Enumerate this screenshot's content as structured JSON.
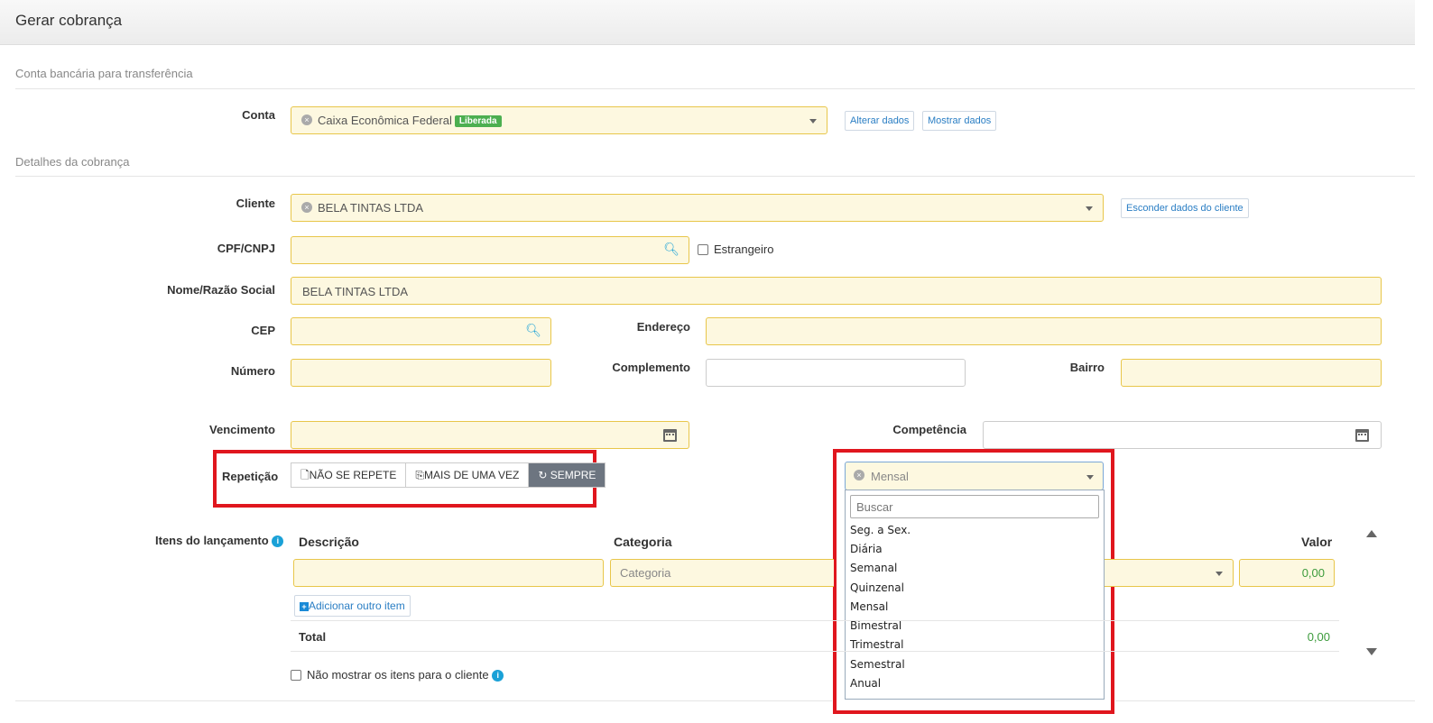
{
  "header": {
    "title": "Gerar cobrança"
  },
  "sections": {
    "bank": "Conta bancária para transferência",
    "details": "Detalhes da cobrança"
  },
  "conta": {
    "label": "Conta",
    "value": "Caixa Econômica Federal",
    "badge": "Liberada",
    "btn_alterar": "Alterar dados",
    "btn_mostrar": "Mostrar dados"
  },
  "cliente": {
    "label": "Cliente",
    "value": "BELA TINTAS LTDA",
    "btn_esconder": "Esconder dados do cliente"
  },
  "cpf": {
    "label": "CPF/CNPJ",
    "value": "",
    "estrangeiro_label": "Estrangeiro"
  },
  "nome": {
    "label": "Nome/Razão Social",
    "value": "BELA TINTAS LTDA"
  },
  "cep": {
    "label": "CEP",
    "value": ""
  },
  "endereco": {
    "label": "Endereço",
    "value": ""
  },
  "numero": {
    "label": "Número",
    "value": ""
  },
  "complemento": {
    "label": "Complemento",
    "value": ""
  },
  "bairro": {
    "label": "Bairro",
    "value": ""
  },
  "vencimento": {
    "label": "Vencimento",
    "value": ""
  },
  "competencia": {
    "label": "Competência",
    "value": ""
  },
  "repeticao": {
    "label": "Repetição",
    "options": [
      "NÃO SE REPETE",
      "MAIS DE UMA VEZ",
      "SEMPRE"
    ],
    "active": "SEMPRE"
  },
  "frequencia": {
    "selected": "Mensal",
    "search_placeholder": "Buscar",
    "options": [
      "Seg. a Sex.",
      "Diária",
      "Semanal",
      "Quinzenal",
      "Mensal",
      "Bimestral",
      "Trimestral",
      "Semestral",
      "Anual"
    ]
  },
  "itens": {
    "label": "Itens do lançamento",
    "col_descricao": "Descrição",
    "col_categoria": "Categoria",
    "col_valor": "Valor",
    "categoria_placeholder": "Categoria",
    "valor": "0,00",
    "add_item": "Adicionar outro item",
    "total_label": "Total",
    "total_value": "0,00",
    "nao_mostrar": "Não mostrar os itens para o cliente"
  },
  "colors": {
    "field_bg": "#fdf8e0",
    "field_border": "#e8c64a",
    "highlight": "#e0161e",
    "link": "#2a7ec4",
    "badge": "#4caf50"
  }
}
